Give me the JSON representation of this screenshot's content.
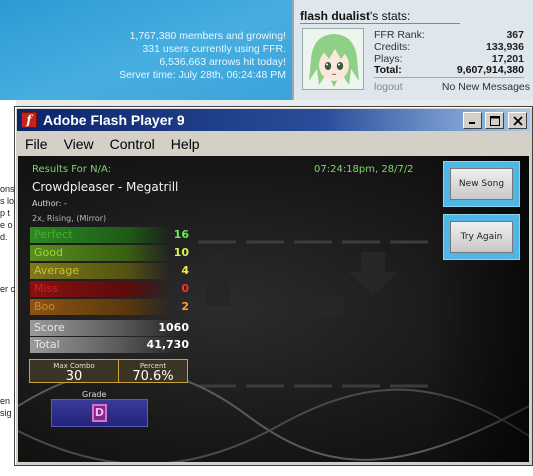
{
  "background_page": {
    "site_stats": {
      "members": "1,767,380 members and growing!",
      "users_online": "331 users currently using FFR.",
      "arrows_hit": "6,536,663 arrows hit today!",
      "server_time": "Server time: July 28th, 06:24:48 PM"
    },
    "user_panel": {
      "username": "flash dualist",
      "title_suffix": "'s stats:",
      "stats": [
        {
          "label": "FFR Rank:",
          "value": "367"
        },
        {
          "label": "Credits:",
          "value": "133,936"
        },
        {
          "label": "Plays:",
          "value": "17,201"
        },
        {
          "label": "Total:",
          "value": "9,607,914,380"
        }
      ],
      "logout_label": "logout",
      "messages_label": "No New Messages"
    },
    "left_edge_fragments": [
      "ons",
      "s lo",
      "p t",
      "e o",
      "d.",
      "er c",
      "en",
      "sig"
    ]
  },
  "window": {
    "title": "Adobe Flash Player 9",
    "menu": [
      "File",
      "View",
      "Control",
      "Help"
    ]
  },
  "game": {
    "results_header": "Results For N/A:",
    "timestamp": "07:24:18pm, 28/7/2",
    "song_title": "Crowdpleaser - Megatrill",
    "author_line": "Author: -",
    "modifiers": "2x, Rising, (Mirror)",
    "judgements": [
      {
        "label": "Perfect",
        "value": "16",
        "bar_color": "#2e8a22",
        "label_color": "#3fb02c",
        "value_color": "#66ee55"
      },
      {
        "label": "Good",
        "value": "10",
        "bar_color": "#5a8e1c",
        "label_color": "#a2d03a",
        "value_color": "#d8f060"
      },
      {
        "label": "Average",
        "value": "4",
        "bar_color": "#7e7a1c",
        "label_color": "#c8c232",
        "value_color": "#f4ec40"
      },
      {
        "label": "Miss",
        "value": "0",
        "bar_color": "#8a1010",
        "label_color": "#d42020",
        "value_color": "#ff3030"
      },
      {
        "label": "Boo",
        "value": "2",
        "bar_color": "#8a5414",
        "label_color": "#d8862a",
        "value_color": "#ffa02a"
      }
    ],
    "score_label": "Score",
    "score_value": "1060",
    "total_label": "Total",
    "total_value": "41,730",
    "max_combo_label": "Max Combo",
    "max_combo_value": "30",
    "percent_label": "Percent",
    "percent_value": "70.6%",
    "grade_label": "Grade",
    "grade_value": "D",
    "buttons": {
      "new_song": "New Song",
      "try_again": "Try Again"
    }
  }
}
